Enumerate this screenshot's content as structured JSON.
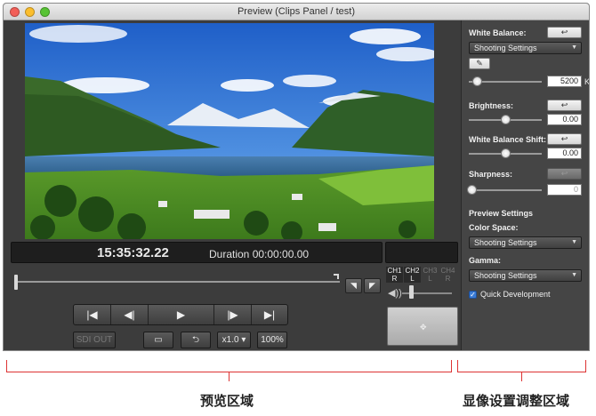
{
  "window": {
    "title": "Preview (Clips Panel / test)"
  },
  "preview": {
    "timecode": "15:35:32.22",
    "duration": "Duration 00:00:00.00"
  },
  "audio": {
    "channels": [
      {
        "top": "CH1",
        "bottom": "R",
        "active": true
      },
      {
        "top": "CH2",
        "bottom": "L",
        "active": true
      },
      {
        "top": "CH3",
        "bottom": "L",
        "active": false
      },
      {
        "top": "CH4",
        "bottom": "R",
        "active": false
      }
    ],
    "volume_icon": "speaker-icon"
  },
  "transport": {
    "buttons": [
      "|◀",
      "◀|",
      "▶",
      "|▶",
      "▶|"
    ],
    "sdi_out": "SDI OUT",
    "speed": "x1.0",
    "zoom": "100%"
  },
  "panel": {
    "white_balance_label": "White Balance:",
    "white_balance_value": "Shooting Settings",
    "kelvin_value": "5200",
    "kelvin_unit": "K",
    "brightness_label": "Brightness:",
    "brightness_value": "0.00",
    "wb_shift_label": "White Balance Shift:",
    "wb_shift_value": "0.00",
    "sharpness_label": "Sharpness:",
    "sharpness_value": "0",
    "preview_settings_label": "Preview Settings",
    "color_space_label": "Color Space:",
    "color_space_value": "Shooting Settings",
    "gamma_label": "Gamma:",
    "gamma_value": "Shooting Settings",
    "quick_dev_label": "Quick Development",
    "quick_dev_checked": true,
    "reset_icon": "undo-arrow-icon"
  },
  "annotations": {
    "left_caption": "预览区域",
    "right_caption": "显像设置调整区域",
    "bracket_color": "#d33333"
  }
}
